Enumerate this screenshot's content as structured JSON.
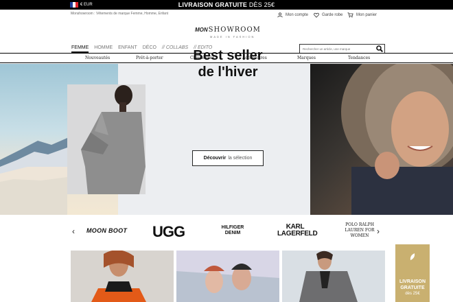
{
  "topbar": {
    "currency": "€ EUR",
    "promo_bold": "LIVRAISON GRATUITE",
    "promo_rest": "DÈS 25€",
    "flag_colors": [
      "#1f3f99",
      "#ffffff",
      "#e0262e"
    ]
  },
  "header": {
    "tagline": "Monshowroom : Vêtements de marque Femme, Homme, Enfant",
    "account_label": "Mon compte",
    "wardrobe_label": "Garde robe",
    "cart_label": "Mon panier",
    "logo_prefix": "MON",
    "logo_main": "SHOWROOM",
    "logo_sub": "MADE IN FASHION"
  },
  "main_nav": {
    "items": [
      "FEMME",
      "HOMME",
      "ENFANT",
      "DÉCO",
      "// COLLABS",
      "// EDITO"
    ],
    "active": "FEMME"
  },
  "search": {
    "placeholder": "Rechercher un article, une marque"
  },
  "sub_nav": {
    "items": [
      "Nouveautés",
      "Prêt-à-porter",
      "Chaussures",
      "Accessoires",
      "Marques",
      "Tendances"
    ]
  },
  "hero": {
    "title_line1": "Best seller",
    "title_line2": "de l'hiver",
    "cta_bold": "Découvrir",
    "cta_light": "la sélection"
  },
  "brands": {
    "items": [
      "MOON BOOT",
      "UGG",
      "HILFIGER DENIM",
      "KARL LAGERFELD",
      "POLO RALPH LAUREN FOR WOMEN"
    ]
  },
  "promo_card": {
    "line1": "LIVRAISON",
    "line2": "GRATUITE",
    "line3": "dès 25€"
  },
  "colors": {
    "black": "#000000",
    "promo_gold": "#c9b070",
    "hero_mid_bg": "#eceef1"
  }
}
